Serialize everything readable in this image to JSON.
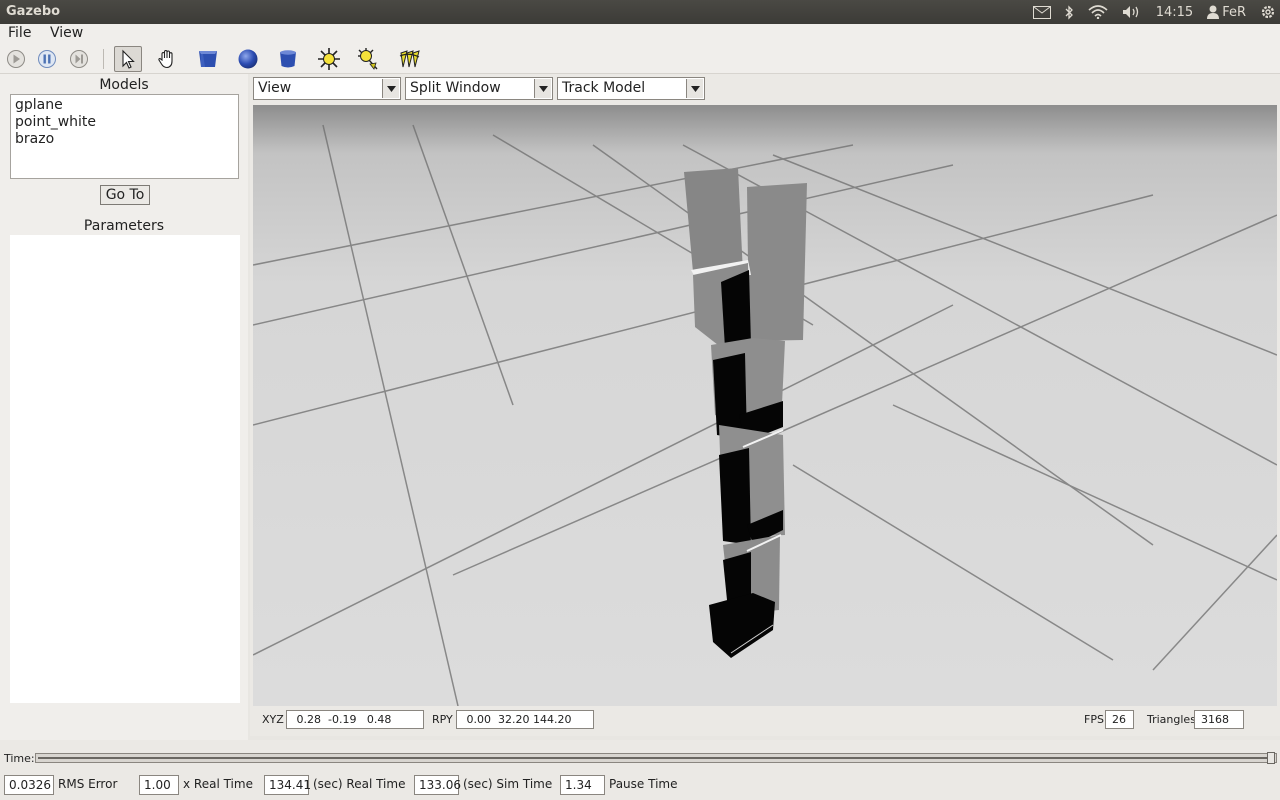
{
  "window": {
    "title": "Gazebo"
  },
  "systray": {
    "time": "14:15",
    "user": "FeR"
  },
  "menu": {
    "file": "File",
    "view": "View"
  },
  "toolbar": {
    "icons": [
      "play-icon",
      "pause-icon",
      "step-icon",
      "select-arrow-icon",
      "hand-move-icon",
      "box-shape-icon",
      "sphere-shape-icon",
      "cylinder-shape-icon",
      "point-light-icon",
      "spot-light-icon",
      "directional-light-icon"
    ]
  },
  "left_panel": {
    "models_label": "Models",
    "models": [
      "gplane",
      "point_white",
      "brazo"
    ],
    "goto_label": "Go To",
    "parameters_label": "Parameters"
  },
  "view_panel": {
    "view_select": "View",
    "split_select": "Split Window",
    "track_select": "Track Model",
    "xyz_label": "XYZ",
    "xyz_value": " 0.28  -0.19   0.48",
    "rpy_label": "RPY",
    "rpy_value": " 0.00  32.20 144.20",
    "fps_label": "FPS",
    "fps_value": "26",
    "triangles_label": "Triangles",
    "triangles_value": "3168"
  },
  "bottom_bar": {
    "time_label": "Time:",
    "time_progress": 1.0,
    "rms_value": "0.0326",
    "rms_label": "RMS Error",
    "factor_value": "1.00",
    "factor_label": "x Real Time",
    "real_time_value": "134.41",
    "real_time_label": "(sec) Real Time",
    "sim_time_value": "133.06",
    "sim_time_label": "(sec) Sim Time",
    "pause_value": "1.34",
    "pause_label": "Pause Time"
  }
}
